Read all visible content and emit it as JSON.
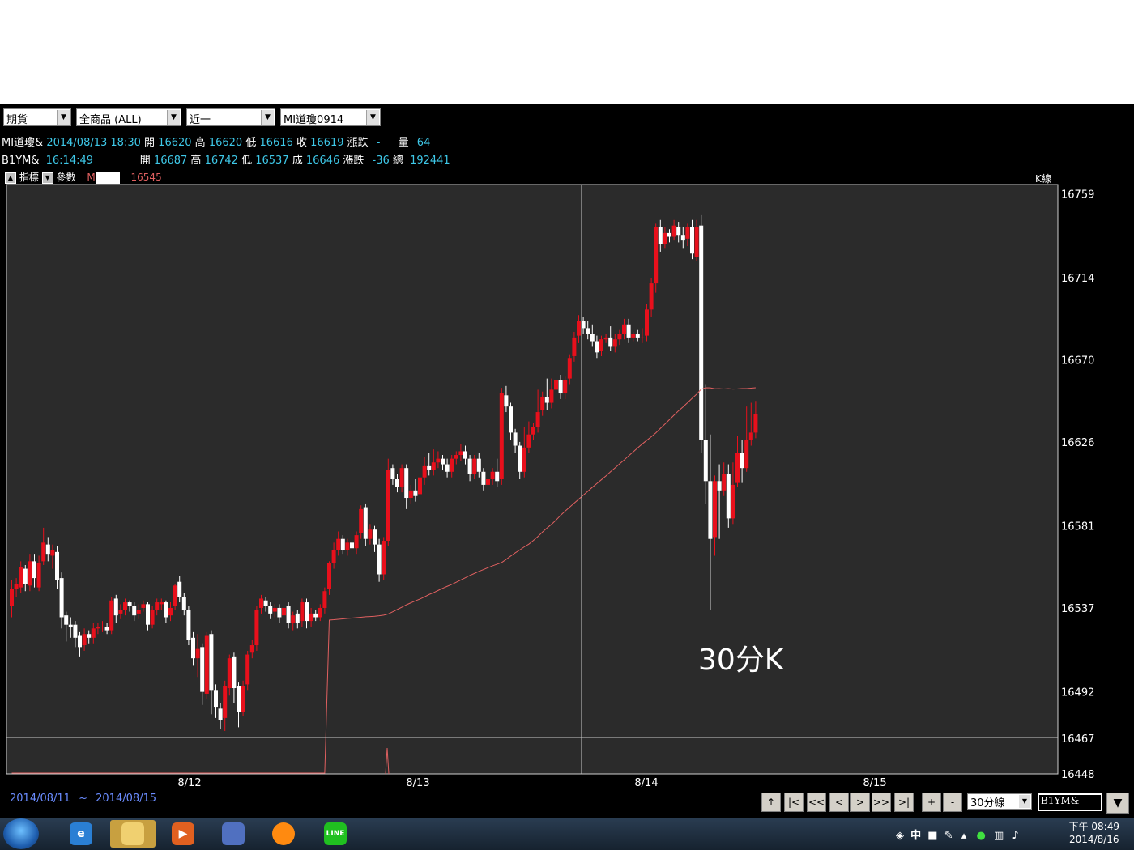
{
  "toolbar": {
    "market": "期貨",
    "product": "全商品       (ALL)",
    "period": "近一",
    "contract": "MI道瓊0914"
  },
  "quote_rows": [
    {
      "symbol": "MI道瓊&",
      "time": "2014/08/13 18:30",
      "open_label": "開",
      "open": "16620",
      "high_label": "高",
      "high": "16620",
      "low_label": "低",
      "low": "16616",
      "close_label": "收",
      "close": "16619",
      "chg_label": "漲跌",
      "chg": "-",
      "extra_label": "量",
      "extra": "64"
    },
    {
      "symbol": "B1YM&",
      "time": "16:14:49",
      "open_label": "開",
      "open": "16687",
      "high_label": "高",
      "high": "16742",
      "low_label": "低",
      "low": "16537",
      "close_label": "成",
      "close": "16646",
      "chg_label": "漲跌",
      "chg": "-36",
      "extra_label": "總",
      "extra": "192441"
    }
  ],
  "indicator_bar": {
    "indicator_label": "指標",
    "params_label": "參數",
    "ma_label": "M",
    "ma_value": "16545",
    "kline_label": "K線"
  },
  "chart_data": {
    "type": "candlestick",
    "annotation": "30分K",
    "y_ticks": [
      "16759",
      "16714",
      "16670",
      "16626",
      "16581",
      "16537",
      "16492",
      "16467",
      "16448"
    ],
    "x_ticks": [
      "8/12",
      "8/13",
      "8/14",
      "8/15"
    ],
    "ylim": [
      16448,
      16764
    ],
    "ma_line_color": "#e06060",
    "up_color": "#e8101c",
    "down_color": "#ffffff",
    "candles": [
      [
        16538,
        16547,
        16532,
        16552
      ],
      [
        16547,
        16550,
        16543,
        16553
      ],
      [
        16548,
        16559,
        16545,
        16562
      ],
      [
        16558,
        16550,
        16546,
        16560
      ],
      [
        16549,
        16562,
        16546,
        16566
      ],
      [
        16562,
        16553,
        16548,
        16566
      ],
      [
        16548,
        16561,
        16546,
        16565
      ],
      [
        16562,
        16572,
        16560,
        16580
      ],
      [
        16571,
        16566,
        16562,
        16575
      ],
      [
        16565,
        16568,
        16558,
        16571
      ],
      [
        16567,
        16552,
        16547,
        16570
      ],
      [
        16553,
        16532,
        16526,
        16556
      ],
      [
        16533,
        16528,
        16519,
        16535
      ],
      [
        16528,
        16527,
        16521,
        16532
      ],
      [
        16528,
        16521,
        16516,
        16530
      ],
      [
        16522,
        16516,
        16511,
        16524
      ],
      [
        16517,
        16523,
        16514,
        16526
      ],
      [
        16523,
        16521,
        16518,
        16525
      ],
      [
        16521,
        16526,
        16518,
        16529
      ],
      [
        16526,
        16527,
        16523,
        16529
      ],
      [
        16527,
        16527,
        16524,
        16530
      ],
      [
        16527,
        16525,
        16523,
        16529
      ],
      [
        16525,
        16541,
        16523,
        16543
      ],
      [
        16542,
        16533,
        16529,
        16544
      ],
      [
        16534,
        16536,
        16531,
        16539
      ],
      [
        16536,
        16540,
        16533,
        16542
      ],
      [
        16540,
        16538,
        16535,
        16541
      ],
      [
        16538,
        16533,
        16530,
        16540
      ],
      [
        16534,
        16536,
        16531,
        16539
      ],
      [
        16537,
        16539,
        16535,
        16541
      ],
      [
        16539,
        16528,
        16525,
        16540
      ],
      [
        16528,
        16536,
        16526,
        16538
      ],
      [
        16536,
        16540,
        16533,
        16542
      ],
      [
        16539,
        16540,
        16536,
        16542
      ],
      [
        16540,
        16532,
        16529,
        16541
      ],
      [
        16533,
        16537,
        16530,
        16540
      ],
      [
        16538,
        16549,
        16536,
        16550
      ],
      [
        16551,
        16543,
        16540,
        16554
      ],
      [
        16543,
        16536,
        16533,
        16545
      ],
      [
        16536,
        16520,
        16517,
        16538
      ],
      [
        16521,
        16510,
        16506,
        16524
      ],
      [
        16510,
        16515,
        16500,
        16523
      ],
      [
        16516,
        16492,
        16485,
        16518
      ],
      [
        16491,
        16522,
        16488,
        16524
      ],
      [
        16523,
        16493,
        16480,
        16525
      ],
      [
        16493,
        16484,
        16478,
        16496
      ],
      [
        16483,
        16477,
        16472,
        16486
      ],
      [
        16478,
        16495,
        16471,
        16498
      ],
      [
        16494,
        16510,
        16490,
        16512
      ],
      [
        16511,
        16494,
        16486,
        16513
      ],
      [
        16495,
        16481,
        16473,
        16497
      ],
      [
        16481,
        16495,
        16479,
        16498
      ],
      [
        16496,
        16512,
        16493,
        16514
      ],
      [
        16513,
        16517,
        16510,
        16520
      ],
      [
        16517,
        16536,
        16514,
        16538
      ],
      [
        16537,
        16542,
        16534,
        16544
      ],
      [
        16541,
        16538,
        16535,
        16543
      ],
      [
        16538,
        16534,
        16531,
        16540
      ],
      [
        16535,
        16537,
        16532,
        16539
      ],
      [
        16537,
        16532,
        16529,
        16539
      ],
      [
        16533,
        16537,
        16530,
        16540
      ],
      [
        16538,
        16529,
        16526,
        16540
      ],
      [
        16529,
        16533,
        16525,
        16535
      ],
      [
        16534,
        16529,
        16526,
        16536
      ],
      [
        16530,
        16540,
        16527,
        16542
      ],
      [
        16540,
        16530,
        16526,
        16542
      ],
      [
        16530,
        16534,
        16527,
        16537
      ],
      [
        16534,
        16532,
        16530,
        16536
      ],
      [
        16532,
        16537,
        16530,
        16539
      ],
      [
        16537,
        16546,
        16534,
        16548
      ],
      [
        16547,
        16561,
        16544,
        16562
      ],
      [
        16561,
        16568,
        16558,
        16572
      ],
      [
        16568,
        16574,
        16565,
        16578
      ],
      [
        16574,
        16568,
        16566,
        16576
      ],
      [
        16568,
        16572,
        16565,
        16574
      ],
      [
        16572,
        16569,
        16566,
        16574
      ],
      [
        16569,
        16576,
        16566,
        16578
      ],
      [
        16577,
        16590,
        16574,
        16592
      ],
      [
        16591,
        16574,
        16570,
        16593
      ],
      [
        16574,
        16579,
        16571,
        16582
      ],
      [
        16579,
        16571,
        16567,
        16581
      ],
      [
        16571,
        16555,
        16551,
        16574
      ],
      [
        16555,
        16573,
        16552,
        16575
      ],
      [
        16573,
        16611,
        16570,
        16617
      ],
      [
        16612,
        16606,
        16603,
        16614
      ],
      [
        16606,
        16602,
        16599,
        16609
      ],
      [
        16602,
        16612,
        16599,
        16614
      ],
      [
        16612,
        16596,
        16590,
        16614
      ],
      [
        16596,
        16600,
        16593,
        16603
      ],
      [
        16600,
        16597,
        16594,
        16606
      ],
      [
        16598,
        16607,
        16595,
        16610
      ],
      [
        16607,
        16613,
        16603,
        16618
      ],
      [
        16613,
        16611,
        16608,
        16620
      ],
      [
        16611,
        16615,
        16608,
        16622
      ],
      [
        16615,
        16617,
        16612,
        16621
      ],
      [
        16617,
        16614,
        16611,
        16619
      ],
      [
        16614,
        16610,
        16607,
        16617
      ],
      [
        16610,
        16617,
        16607,
        16619
      ],
      [
        16617,
        16619,
        16614,
        16621
      ],
      [
        16619,
        16621,
        16616,
        16625
      ],
      [
        16621,
        16617,
        16614,
        16624
      ],
      [
        16617,
        16609,
        16605,
        16619
      ],
      [
        16609,
        16617,
        16606,
        16619
      ],
      [
        16617,
        16610,
        16607,
        16620
      ],
      [
        16610,
        16603,
        16600,
        16612
      ],
      [
        16603,
        16606,
        16598,
        16614
      ],
      [
        16606,
        16610,
        16603,
        16612
      ],
      [
        16610,
        16605,
        16602,
        16617
      ],
      [
        16606,
        16652,
        16603,
        16655
      ],
      [
        16651,
        16645,
        16642,
        16656
      ],
      [
        16645,
        16631,
        16627,
        16647
      ],
      [
        16631,
        16624,
        16620,
        16633
      ],
      [
        16624,
        16610,
        16606,
        16626
      ],
      [
        16610,
        16623,
        16607,
        16634
      ],
      [
        16623,
        16630,
        16620,
        16637
      ],
      [
        16630,
        16634,
        16627,
        16636
      ],
      [
        16634,
        16642,
        16631,
        16654
      ],
      [
        16643,
        16650,
        16640,
        16653
      ],
      [
        16650,
        16647,
        16643,
        16660
      ],
      [
        16647,
        16654,
        16644,
        16660
      ],
      [
        16654,
        16659,
        16650,
        16661
      ],
      [
        16659,
        16652,
        16649,
        16662
      ],
      [
        16652,
        16659,
        16649,
        16661
      ],
      [
        16660,
        16671,
        16657,
        16673
      ],
      [
        16672,
        16682,
        16669,
        16685
      ],
      [
        16683,
        16691,
        16679,
        16694
      ],
      [
        16691,
        16687,
        16684,
        16693
      ],
      [
        16687,
        16684,
        16681,
        16691
      ],
      [
        16684,
        16680,
        16677,
        16689
      ],
      [
        16680,
        16674,
        16671,
        16683
      ],
      [
        16675,
        16681,
        16672,
        16683
      ],
      [
        16681,
        16682,
        16679,
        16684
      ],
      [
        16682,
        16677,
        16675,
        16688
      ],
      [
        16677,
        16681,
        16674,
        16684
      ],
      [
        16681,
        16684,
        16678,
        16686
      ],
      [
        16684,
        16689,
        16681,
        16692
      ],
      [
        16689,
        16682,
        16679,
        16692
      ],
      [
        16682,
        16684,
        16680,
        16685
      ],
      [
        16684,
        16682,
        16680,
        16686
      ],
      [
        16682,
        16682,
        16679,
        16687
      ],
      [
        16683,
        16697,
        16680,
        16700
      ],
      [
        16697,
        16711,
        16693,
        16714
      ],
      [
        16711,
        16741,
        16706,
        16743
      ],
      [
        16741,
        16732,
        16728,
        16745
      ],
      [
        16732,
        16738,
        16730,
        16741
      ],
      [
        16738,
        16736,
        16733,
        16740
      ],
      [
        16736,
        16742,
        16734,
        16745
      ],
      [
        16741,
        16737,
        16733,
        16744
      ],
      [
        16737,
        16734,
        16730,
        16741
      ],
      [
        16735,
        16741,
        16731,
        16743
      ],
      [
        16741,
        16727,
        16724,
        16745
      ],
      [
        16725,
        16741,
        16723,
        16745
      ],
      [
        16742,
        16627,
        16620,
        16748
      ],
      [
        16627,
        16605,
        16593,
        16657
      ],
      [
        16605,
        16574,
        16536,
        16630
      ],
      [
        16575,
        16605,
        16565,
        16608
      ],
      [
        16605,
        16600,
        16574,
        16614
      ],
      [
        16600,
        16609,
        16597,
        16615
      ],
      [
        16609,
        16585,
        16580,
        16614
      ],
      [
        16585,
        16603,
        16582,
        16615
      ],
      [
        16604,
        16620,
        16602,
        16629
      ],
      [
        16620,
        16612,
        16604,
        16627
      ],
      [
        16612,
        16627,
        16610,
        16645
      ],
      [
        16627,
        16631,
        16624,
        16647
      ],
      [
        16631,
        16641,
        16628,
        16648
      ]
    ],
    "ma": [
      [
        16448,
        16448
      ],
      [
        16448,
        16448
      ],
      [
        16448,
        16448
      ],
      [
        16448,
        16448
      ],
      [
        16448,
        16448
      ],
      [
        16448,
        16448
      ],
      [
        16448,
        16448
      ],
      [
        16448,
        16448
      ],
      [
        16448,
        16448
      ],
      [
        16448,
        16448
      ],
      [
        16448,
        16448
      ],
      [
        16448,
        16448
      ],
      [
        16448,
        16448
      ],
      [
        16448,
        16448
      ],
      [
        16448,
        16448
      ],
      [
        16448,
        16448
      ],
      [
        16448,
        16448
      ],
      [
        16448,
        16448
      ],
      [
        16448,
        16448
      ],
      [
        16448,
        16448
      ]
    ]
  },
  "footer": {
    "date_from": "2014/08/11",
    "date_sep": "~",
    "date_to": "2014/08/15",
    "nav_buttons": [
      "↑",
      "|<",
      "<<",
      "<",
      ">",
      ">>",
      ">|",
      "+",
      "-"
    ],
    "interval": "30分線",
    "symbol": "B1YM&"
  },
  "taskbar": {
    "time": "下午 08:49",
    "date": "2014/8/16",
    "ime": "中"
  }
}
